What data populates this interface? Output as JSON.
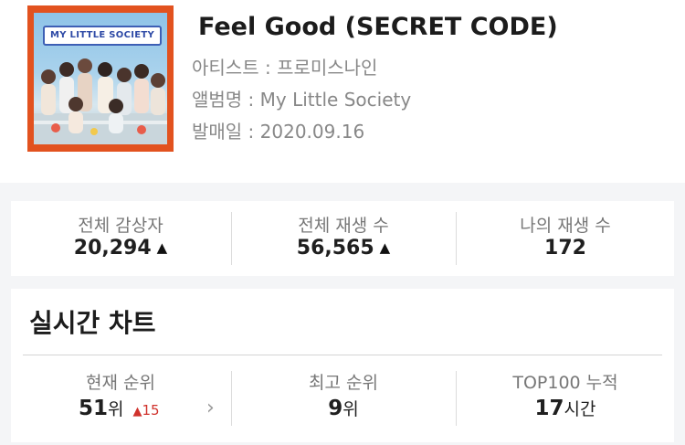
{
  "album_art": {
    "cover_text": "MY LITTLE SOCIETY"
  },
  "song": {
    "title": "Feel Good (SECRET CODE)",
    "artist_label": "아티스트 : ",
    "artist": "프로미스나인",
    "album_label": "앨범명 : ",
    "album": "My Little Society",
    "release_label": "발매일 : ",
    "release_date": "2020.09.16"
  },
  "stats": {
    "total_listeners_label": "전체 감상자",
    "total_listeners": "20,294",
    "total_plays_label": "전체 재생 수",
    "total_plays": "56,565",
    "my_plays_label": "나의 재생 수",
    "my_plays": "172",
    "up_icon": "arrow-up-icon"
  },
  "chart": {
    "title": "실시간 차트",
    "current_rank_label": "현재 순위",
    "current_rank": "51",
    "rank_unit": "위",
    "rank_change": "15",
    "best_rank_label": "최고 순위",
    "best_rank": "9",
    "top100_label": "TOP100 누적",
    "top100_hours": "17",
    "hours_unit": "시간",
    "change_color": "#d0322c"
  }
}
